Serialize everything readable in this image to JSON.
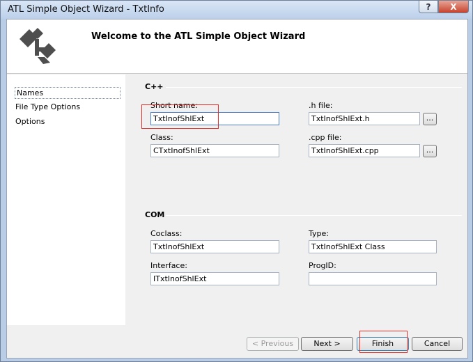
{
  "window": {
    "title": "ATL Simple Object Wizard - TxtInfo",
    "help_label": "?",
    "close_label": "X"
  },
  "header": {
    "title": "Welcome to the ATL Simple Object Wizard",
    "logo_icon": "atl-wizard-logo-icon"
  },
  "nav": {
    "items": [
      {
        "label": "Names"
      },
      {
        "label": "File Type Options"
      },
      {
        "label": "Options"
      }
    ]
  },
  "cpp": {
    "title": "C++",
    "short_name": {
      "label": "Short name:",
      "value": "TxtInofShlExt"
    },
    "h_file": {
      "label": ".h file:",
      "value": "TxtInofShlExt.h"
    },
    "class": {
      "label": "Class:",
      "value": "CTxtInofShlExt"
    },
    "cpp_file": {
      "label": ".cpp file:",
      "value": "TxtInofShlExt.cpp"
    },
    "browse_label": "..."
  },
  "com": {
    "title": "COM",
    "coclass": {
      "label": "Coclass:",
      "value": "TxtInofShlExt"
    },
    "type": {
      "label": "Type:",
      "value": "TxtInofShlExt Class"
    },
    "interface": {
      "label": "Interface:",
      "value": "ITxtInofShlExt"
    },
    "progid": {
      "label": "ProgID:",
      "value": ""
    }
  },
  "footer": {
    "previous": "< Previous",
    "next": "Next >",
    "finish": "Finish",
    "cancel": "Cancel"
  }
}
